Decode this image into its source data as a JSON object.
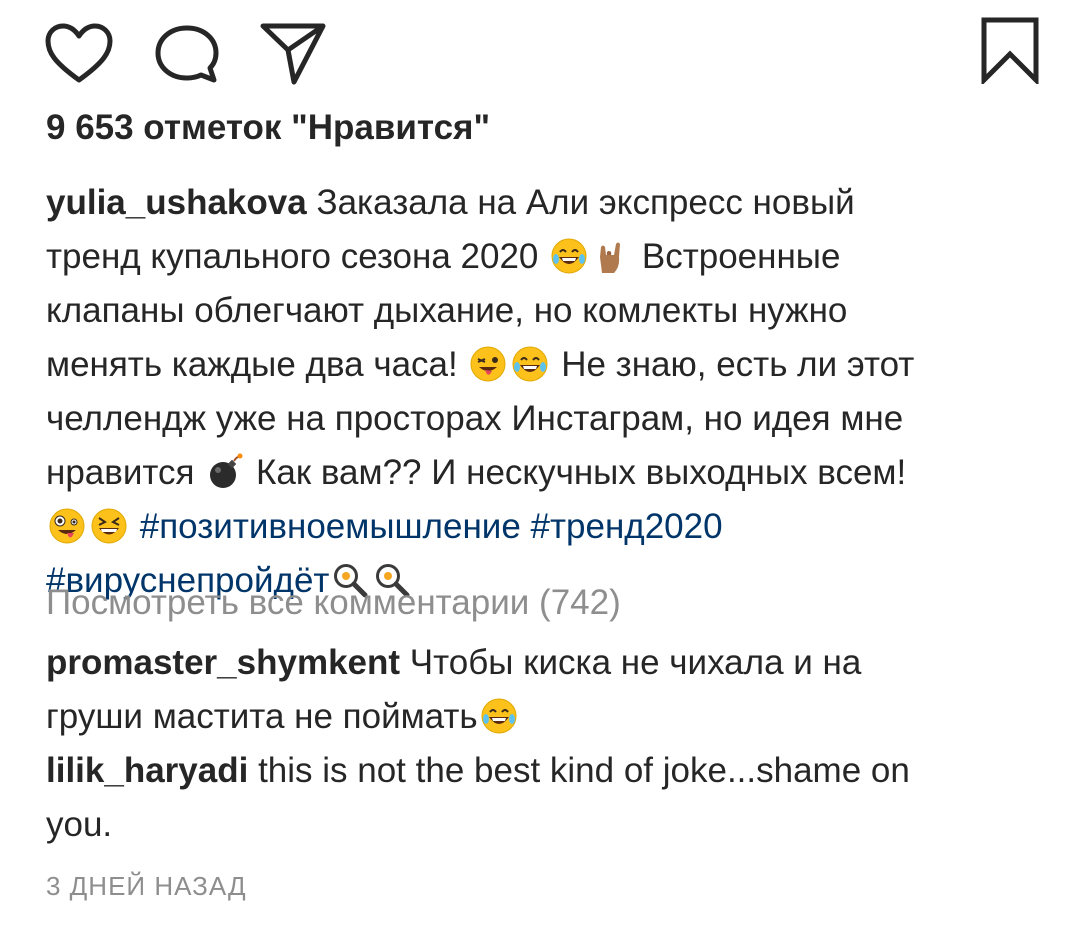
{
  "actions": {
    "like_icon": "heart-icon",
    "comment_icon": "comment-icon",
    "share_icon": "send-icon",
    "save_icon": "bookmark-icon"
  },
  "likes_text": "9 653 отметок \"Нравится\"",
  "caption": {
    "username": "yulia_ushakova",
    "line1": "Заказала на Али экспресс новый",
    "line2a": "тренд купального сезона 2020",
    "line2b": "Встроенные",
    "line3": "клапаны облегчают дыхание, но комлекты нужно",
    "line4a": "менять каждые два часа!",
    "line4b": "Не знаю, есть ли этот",
    "line5": "челлендж уже на просторах Инстаграм, но идея мне",
    "line6a": "нравится",
    "line6b": "Как вам?? И нескучных выходных всем!",
    "hashtag1": "#позитивноемышление",
    "hashtag2": "#тренд2020",
    "hashtag3": "#вируснепройдёт"
  },
  "view_all_comments": "Посмотреть все комментарии (742)",
  "comments": [
    {
      "username": "promaster_shymkent",
      "text_line1": "Чтобы киска не чихала и на",
      "text_line2": "груши мастита не поймать"
    },
    {
      "username": "lilik_haryadi",
      "text_line1": "this is not the best kind of joke...shame on",
      "text_line2": "you."
    }
  ],
  "timestamp": "3 ДНЕЙ НАЗАД",
  "colors": {
    "text": "#262626",
    "muted": "#8e8e8e",
    "hashtag": "#003569",
    "emoji_yellow": "#fcc21b"
  }
}
